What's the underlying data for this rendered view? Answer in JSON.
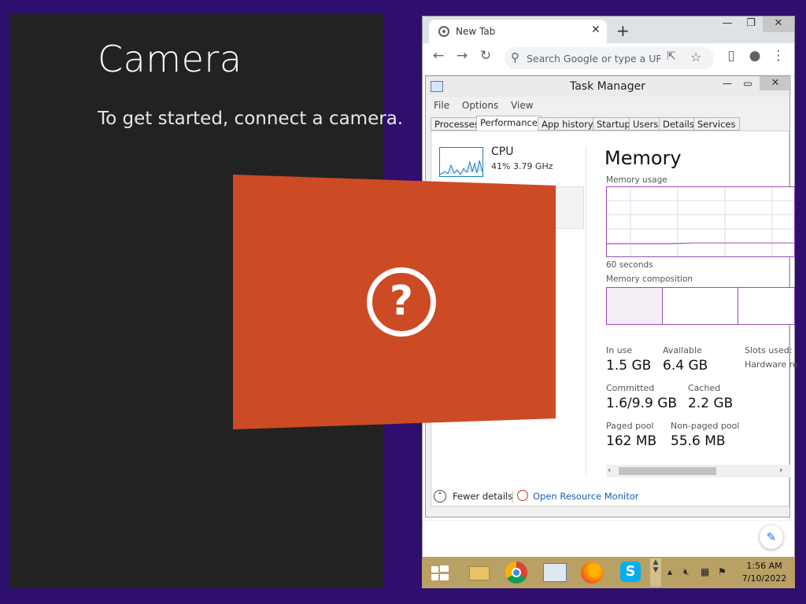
{
  "camera": {
    "title": "Camera",
    "message": "To get started, connect a camera."
  },
  "browser": {
    "tab_title": "New Tab",
    "new_tab_symbol": "+",
    "omnibox_placeholder": "Search Google or type a URL",
    "window_buttons": {
      "minimize": "—",
      "maximize": "❐",
      "close": "✕"
    }
  },
  "taskmgr": {
    "title": "Task Manager",
    "menu": [
      "File",
      "Options",
      "View"
    ],
    "tabs": [
      "Processes",
      "Performance",
      "App history",
      "Startup",
      "Users",
      "Details",
      "Services"
    ],
    "active_tab": "Performance",
    "sidebar": {
      "cpu_label": "CPU",
      "cpu_sub": "41%  3.79 GHz"
    },
    "memory": {
      "title": "Memory",
      "usage_label": "Memory usage",
      "seconds_label": "60 seconds",
      "composition_label": "Memory composition",
      "stats": {
        "in_use_label": "In use",
        "in_use": "1.5 GB",
        "available_label": "Available",
        "available": "6.4 GB",
        "slots_label": "Slots used:",
        "hardware_label": "Hardware re",
        "committed_label": "Committed",
        "committed": "1.6/9.9 GB",
        "cached_label": "Cached",
        "cached": "2.2 GB",
        "paged_label": "Paged pool",
        "paged": "162 MB",
        "nonpaged_label": "Non-paged pool",
        "nonpaged": "55.6 MB"
      }
    },
    "footer": {
      "fewer_details": "Fewer details",
      "open_resource_monitor": "Open Resource Monitor"
    }
  },
  "taskbar": {
    "time": "1:56 AM",
    "date": "7/10/2022"
  },
  "colors": {
    "desktop": "#2e0f6e",
    "camera_bg": "#222222",
    "overlay": "#cc4a24",
    "taskbar": "#b9a064",
    "memory_accent": "#9b4cb6"
  },
  "icons": [
    "chrome-favicon-icon",
    "question-mark-icon",
    "windows-start-icon",
    "file-explorer-icon",
    "chrome-icon",
    "task-manager-icon",
    "firefox-icon",
    "skype-icon",
    "volume-muted-icon",
    "network-icon",
    "action-center-icon"
  ]
}
